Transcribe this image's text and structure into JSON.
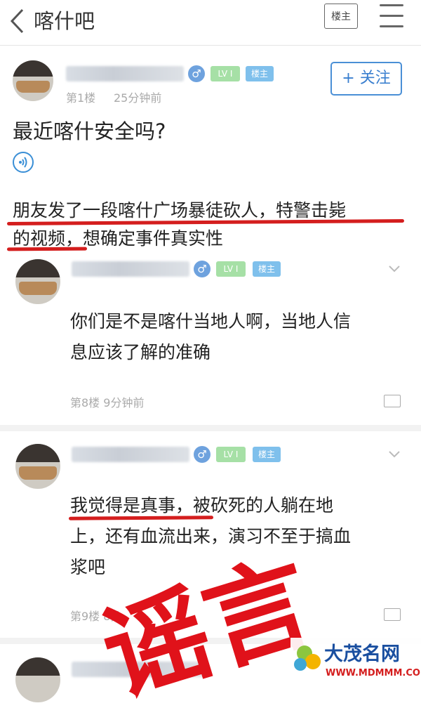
{
  "header": {
    "title": "喀什吧",
    "louzhu_button": "楼主"
  },
  "op": {
    "floor": "第1楼",
    "time": "25分钟前",
    "gender_symbol": "♂",
    "level": "LV I",
    "tag": "楼主",
    "follow_label": "+ 关注",
    "title": "最近喀什安全吗?",
    "body_line1": "朋友发了一段喀什广场暴徒砍人，特警击毙",
    "body_line2": "的视频，想确定事件真实性"
  },
  "replies": [
    {
      "gender_symbol": "♂",
      "level": "LV I",
      "tag": "楼主",
      "text_line1": "你们是不是喀什当地人啊，当地人信",
      "text_line2": "息应该了解的准确",
      "floor_time": "第8楼  9分钟前"
    },
    {
      "gender_symbol": "♂",
      "level": "LV I",
      "tag": "楼主",
      "text_line1": "我觉得是真事，被砍死的人躺在地",
      "text_line2": "上，还有血流出来，演习不至于搞血",
      "text_line3": "浆吧",
      "floor_time": "第9楼  8分"
    }
  ],
  "stamp": {
    "text": "谣言",
    "color": "#e0121a"
  },
  "watermark": {
    "name": "大茂名网",
    "url": "WWW.MDMMM.COM"
  },
  "colors": {
    "accent": "#4a8fd6",
    "underline": "#d41e1e"
  }
}
